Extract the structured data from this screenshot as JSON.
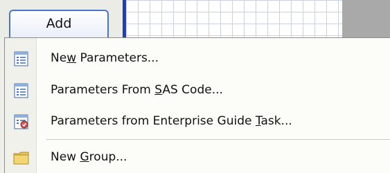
{
  "toolbar": {
    "add_label": "Add"
  },
  "menu": {
    "items": [
      {
        "pre": "Ne",
        "accel": "w",
        "post": " Parameters...",
        "icon": "parameter-list-icon"
      },
      {
        "pre": "Parameters From ",
        "accel": "S",
        "post": "AS Code...",
        "icon": "parameter-list-icon"
      },
      {
        "pre": "Parameters from Enterprise Guide ",
        "accel": "T",
        "post": "ask...",
        "icon": "task-parameters-icon"
      },
      {
        "pre": "New ",
        "accel": "G",
        "post": "roup...",
        "icon": "folder-icon"
      }
    ]
  },
  "colors": {
    "add_button_border": "#4a74c9",
    "insertion_bar": "#1e3fb8",
    "folder": "#e8c55a"
  }
}
